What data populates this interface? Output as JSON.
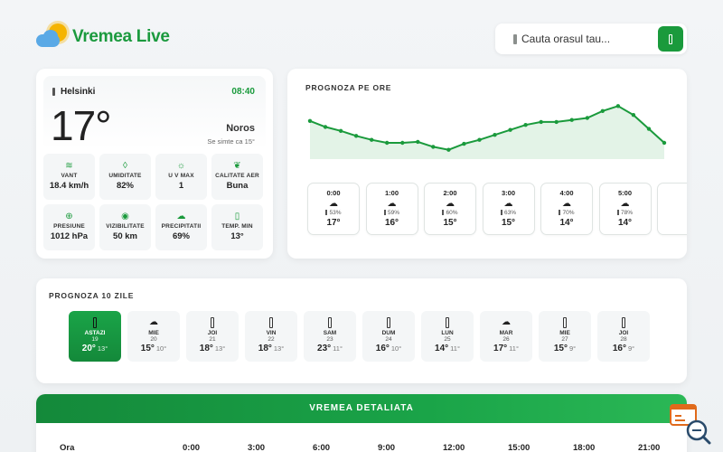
{
  "header": {
    "app_name": "Vremea Live",
    "search_placeholder": "Cauta orasul tau..."
  },
  "current": {
    "city": "Helsinki",
    "time": "08:40",
    "temperature": "17°",
    "condition": "Noros",
    "feels_like": "Se simte ca 15°",
    "stats": [
      {
        "icon": "wind-icon",
        "glyph": "≋",
        "label": "VANT",
        "value": "18.4 km/h"
      },
      {
        "icon": "droplet-icon",
        "glyph": "◊",
        "label": "UMIDITATE",
        "value": "82%"
      },
      {
        "icon": "sun-icon",
        "glyph": "☼",
        "label": "U V MAX",
        "value": "1"
      },
      {
        "icon": "air-quality-icon",
        "glyph": "❦",
        "label": "CALITATE AER",
        "value": "Buna"
      },
      {
        "icon": "pressure-icon",
        "glyph": "⊕",
        "label": "PRESIUNE",
        "value": "1012 hPa"
      },
      {
        "icon": "eye-icon",
        "glyph": "◉",
        "label": "VIZIBILITATE",
        "value": "50 km"
      },
      {
        "icon": "cloud-rain-icon",
        "glyph": "☁",
        "label": "PRECIPITATII",
        "value": "69%"
      },
      {
        "icon": "thermometer-icon",
        "glyph": "▯",
        "label": "TEMP. MIN",
        "value": "13°"
      }
    ]
  },
  "hourly": {
    "title": "PROGNOZA PE ORE",
    "items": [
      {
        "hour": "0:00",
        "precip": "53%",
        "temp": "17°"
      },
      {
        "hour": "1:00",
        "precip": "59%",
        "temp": "16°"
      },
      {
        "hour": "2:00",
        "precip": "60%",
        "temp": "15°"
      },
      {
        "hour": "3:00",
        "precip": "63%",
        "temp": "15°"
      },
      {
        "hour": "4:00",
        "precip": "70%",
        "temp": "14°"
      },
      {
        "hour": "5:00",
        "precip": "78%",
        "temp": "14°"
      }
    ]
  },
  "chart_data": {
    "type": "area",
    "x": [
      0,
      1,
      2,
      3,
      4,
      5,
      6,
      7,
      8,
      9,
      10,
      11,
      12,
      13,
      14,
      15,
      16,
      17,
      18,
      19,
      20,
      21,
      22,
      23
    ],
    "values": [
      17.2,
      16.6,
      16.2,
      15.7,
      15.3,
      15.0,
      15.0,
      15.1,
      14.6,
      14.3,
      14.9,
      15.3,
      15.8,
      16.3,
      16.8,
      17.1,
      17.1,
      17.3,
      17.5,
      18.2,
      18.7,
      17.8,
      16.4,
      15.0
    ],
    "ylim": [
      13,
      19
    ],
    "grid": false,
    "color": "#1a9a3c"
  },
  "daily": {
    "title": "PROGNOZA 10 ZILE",
    "items": [
      {
        "name": "ASTAZI",
        "date": "19",
        "max": "20°",
        "min": "13°",
        "icon": "rain",
        "active": true
      },
      {
        "name": "MIE",
        "date": "20",
        "max": "15°",
        "min": "10°",
        "icon": "cloud",
        "active": false
      },
      {
        "name": "JOI",
        "date": "21",
        "max": "18°",
        "min": "13°",
        "icon": "rain",
        "active": false
      },
      {
        "name": "VIN",
        "date": "22",
        "max": "18°",
        "min": "13°",
        "icon": "rain",
        "active": false
      },
      {
        "name": "SAM",
        "date": "23",
        "max": "23°",
        "min": "11°",
        "icon": "rain",
        "active": false
      },
      {
        "name": "DUM",
        "date": "24",
        "max": "16°",
        "min": "10°",
        "icon": "rain",
        "active": false
      },
      {
        "name": "LUN",
        "date": "25",
        "max": "14°",
        "min": "11°",
        "icon": "rain",
        "active": false
      },
      {
        "name": "MAR",
        "date": "26",
        "max": "17°",
        "min": "11°",
        "icon": "cloud",
        "active": false
      },
      {
        "name": "MIE",
        "date": "27",
        "max": "15°",
        "min": "9°",
        "icon": "rain",
        "active": false
      },
      {
        "name": "JOI",
        "date": "28",
        "max": "16°",
        "min": "9°",
        "icon": "rain",
        "active": false
      }
    ]
  },
  "detailed": {
    "title": "VREMEA DETALIATA",
    "row_label": "Ora",
    "hours": [
      "0:00",
      "3:00",
      "6:00",
      "9:00",
      "12:00",
      "15:00",
      "18:00",
      "21:00"
    ]
  },
  "colors": {
    "accent": "#1a9a3c",
    "background": "#f3f5f7"
  }
}
